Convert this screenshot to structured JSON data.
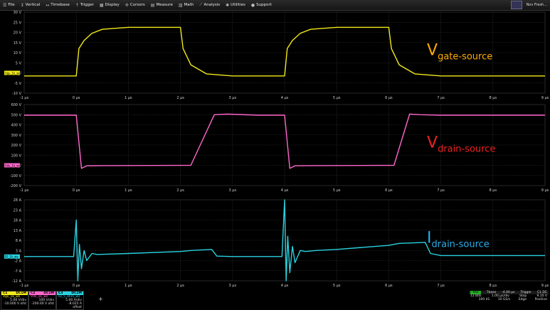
{
  "menu": [
    {
      "icon": "file-icon",
      "glyph": "☰",
      "label": "File"
    },
    {
      "icon": "vertical-icon",
      "glyph": "↕",
      "label": "Vertical"
    },
    {
      "icon": "timebase-icon",
      "glyph": "↔",
      "label": "Timebase"
    },
    {
      "icon": "trigger-icon",
      "glyph": "↑",
      "label": "Trigger"
    },
    {
      "icon": "display-icon",
      "glyph": "▦",
      "label": "Display"
    },
    {
      "icon": "cursors-icon",
      "glyph": "✣",
      "label": "Cursors"
    },
    {
      "icon": "measure-icon",
      "glyph": "▤",
      "label": "Measure"
    },
    {
      "icon": "math-icon",
      "glyph": "▥",
      "label": "Math"
    },
    {
      "icon": "analysis-icon",
      "glyph": "⟋",
      "label": "Analysis"
    },
    {
      "icon": "utilities-icon",
      "glyph": "✱",
      "label": "Utilities"
    },
    {
      "icon": "support-icon",
      "glyph": "●",
      "label": "Support"
    }
  ],
  "menubar_right": {
    "label": "Nov Fresh..."
  },
  "x_ticks": [
    "-1 µs",
    "0 µs",
    "1 µs",
    "2 µs",
    "3 µs",
    "4 µs",
    "5 µs",
    "6 µs",
    "7 µs",
    "8 µs",
    "9 µs"
  ],
  "chart_data": [
    {
      "type": "line",
      "y_ticks": [
        "30 V",
        "25 V",
        "20 V",
        "15 V",
        "10 V",
        "5 V",
        "0 V",
        "-5 V",
        "-10 V"
      ],
      "ylim": [
        -10,
        30
      ],
      "color": "#f2ea1a",
      "marker_label": "Vgs_1k_ws",
      "annotation": {
        "main": "V",
        "sub": "gate-source",
        "color": "#ffaa00"
      },
      "series": [
        {
          "x": [
            -1.0,
            0.0,
            0.05,
            0.15,
            0.3,
            0.5,
            1.0,
            2.0,
            2.05,
            2.2,
            2.5,
            3.0,
            4.0,
            4.05,
            4.15,
            4.3,
            4.5,
            5.0,
            6.0,
            6.05,
            6.2,
            6.5,
            7.0,
            9.0
          ],
          "y": [
            -1.5,
            -1.5,
            12,
            16,
            19.5,
            21.5,
            22.5,
            22.5,
            12,
            4,
            -0.5,
            -1.5,
            -1.5,
            12,
            16,
            19.5,
            21.5,
            22.5,
            22.5,
            12,
            4,
            -0.5,
            -1.5,
            -1.5
          ]
        }
      ]
    },
    {
      "type": "line",
      "y_ticks": [
        "600 V",
        "500 V",
        "400 V",
        "300 V",
        "200 V",
        "100 V",
        "0 V",
        "-100 V",
        "-200 V"
      ],
      "ylim": [
        -200,
        600
      ],
      "color": "#ff66cc",
      "marker_label": "Vds_1k_ws",
      "annotation": {
        "main": "V",
        "sub": "drain-source",
        "color": "#ee2222"
      },
      "series": [
        {
          "x": [
            -1.0,
            0.0,
            0.1,
            0.2,
            0.5,
            2.2,
            2.65,
            2.9,
            3.5,
            4.0,
            4.1,
            4.2,
            4.5,
            6.1,
            6.4,
            6.6,
            7.0,
            9.0
          ],
          "y": [
            495,
            495,
            -30,
            -5,
            -3,
            0,
            500,
            505,
            495,
            495,
            -30,
            -5,
            -3,
            0,
            505,
            500,
            495,
            495
          ]
        }
      ]
    },
    {
      "type": "line",
      "y_ticks": [
        "28 A",
        "23 A",
        "18 A",
        "13 A",
        "8 A",
        "3 A",
        "-2 A",
        "-7 A",
        "-12 A"
      ],
      "ylim": [
        -12,
        28
      ],
      "color": "#29d2e0",
      "marker_label": "ID_1k_ws",
      "annotation": {
        "main": "I",
        "sub": "drain-source",
        "color": "#29aeea"
      },
      "series": [
        {
          "x": [
            -1.0,
            -0.05,
            0.0,
            0.03,
            0.06,
            0.1,
            0.15,
            0.2,
            0.3,
            0.4,
            0.6,
            1.0,
            2.0,
            2.2,
            2.6,
            2.7,
            3.0,
            3.95,
            4.0,
            4.03,
            4.06,
            4.1,
            4.15,
            4.2,
            4.3,
            4.4,
            4.6,
            5.0,
            6.0,
            6.2,
            6.7,
            6.8,
            7.0,
            9.0
          ],
          "y": [
            0,
            0,
            18,
            -12,
            6,
            -6,
            3,
            -2,
            1.5,
            1,
            1.2,
            1.5,
            2.5,
            3,
            3.5,
            0.2,
            0,
            0,
            28,
            -12,
            10,
            -8,
            5,
            -3,
            3,
            2.5,
            3,
            3.5,
            5.5,
            6.5,
            7,
            1.5,
            0.5,
            0.5
          ]
        }
      ]
    }
  ],
  "channels": [
    {
      "id": "C1",
      "badge": "DC1M",
      "name": "Vgs_1k_ws",
      "scale": "5.00 V/div",
      "offset": "-10.000 V ofst",
      "color": "#f2ea1a"
    },
    {
      "id": "C2",
      "badge": "DC1M",
      "name": "Vds_1k_ws",
      "scale": "100 V/div",
      "offset": "-200.00 V ofst",
      "color": "#ff66cc"
    },
    {
      "id": "C3",
      "badge": "DC1M",
      "name": "ID_5_ohm_ws",
      "scale": "5.00 A/div",
      "offset": "-8.025 A offset",
      "color": "#29d2e0"
    }
  ],
  "timebase": {
    "hd_label": "HD",
    "bits": "12 Bits",
    "tbase_label": "Tbase",
    "tbase_value": "-4.00 µs",
    "trigger_label": "Trigger",
    "trigger_code": "C1 DC",
    "per_div": "1.00 µs/div",
    "mode": "Stop",
    "level": "9.10 V",
    "samples": "100 kS",
    "rate": "10 GS/s",
    "type": "Edge",
    "slope": "Positive"
  }
}
